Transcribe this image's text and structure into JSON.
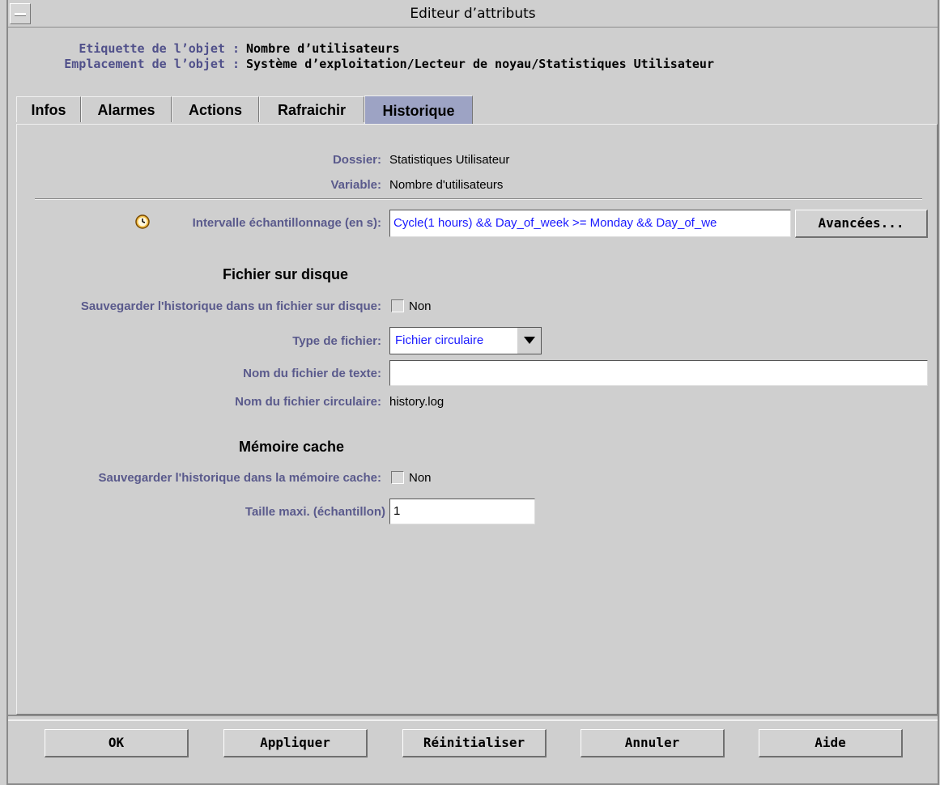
{
  "window": {
    "title": "Editeur d’attributs"
  },
  "object": {
    "label_caption": "Etiquette de l’objet :",
    "label_value": "Nombre d’utilisateurs",
    "location_caption": "Emplacement de l’objet :",
    "location_value": "Système d’exploitation/Lecteur de noyau/Statistiques Utilisateur"
  },
  "tabs": [
    {
      "label": "Infos"
    },
    {
      "label": "Alarmes"
    },
    {
      "label": "Actions"
    },
    {
      "label": "Rafraichir"
    },
    {
      "label": "Historique",
      "active": true
    }
  ],
  "history": {
    "folder_label": "Dossier:",
    "folder_value": "Statistiques Utilisateur",
    "variable_label": "Variable:",
    "variable_value": "Nombre d'utilisateurs",
    "interval_label": "Intervalle échantillonnage (en s):",
    "interval_value": "Cycle(1 hours) && Day_of_week >= Monday && Day_of_we",
    "advanced_button": "Avancées...",
    "disk_section": "Fichier sur disque",
    "save_disk_label": "Sauvegarder l'historique dans un fichier sur disque:",
    "save_disk_value": "Non",
    "file_type_label": "Type de fichier:",
    "file_type_value": "Fichier circulaire",
    "text_file_label": "Nom du fichier de texte:",
    "text_file_value": "",
    "circular_file_label": "Nom du fichier circulaire:",
    "circular_file_value": "history.log",
    "cache_section": "Mémoire cache",
    "save_cache_label": "Sauvegarder l'historique dans la mémoire cache:",
    "save_cache_value": "Non",
    "max_size_label": "Taille maxi. (échantillon)",
    "max_size_value": "1"
  },
  "buttons": {
    "ok": "OK",
    "apply": "Appliquer",
    "reset": "Réinitialiser",
    "cancel": "Annuler",
    "help": "Aide"
  },
  "colors": {
    "label": "#5a5a8c",
    "active_tab": "#9da3c4",
    "field_text": "#1a1aff"
  }
}
